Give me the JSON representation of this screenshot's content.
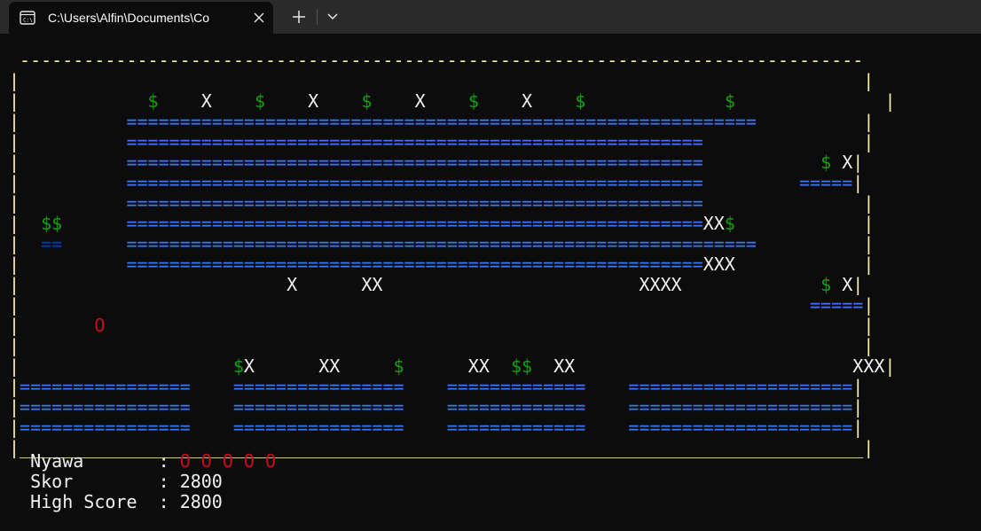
{
  "window": {
    "tab_title": "C:\\Users\\Alfin\\Documents\\Co",
    "tab_icon": "terminal-icon",
    "close_icon": "close-icon",
    "new_tab_icon": "plus-icon",
    "dropdown_icon": "chevron-down-icon"
  },
  "colors": {
    "border": "#f9f1a5",
    "coin": "#13a10e",
    "obstacle": "#f2f2f2",
    "platform": "#3b78ff",
    "platform_dark": "#0037da",
    "player": "#c50f1f",
    "background": "#0c0c0c",
    "titlebar": "#2a2a2a"
  },
  "screen": {
    "lines": [
      [
        {
          "c": "y",
          "t": " ------------------------------------------------------------------------------- "
        }
      ],
      [
        {
          "c": "y",
          "t": "|"
        },
        {
          "c": "w",
          "t": "                                                                               "
        },
        {
          "c": "y",
          "t": "|"
        }
      ],
      [
        {
          "c": "y",
          "t": "|"
        },
        {
          "c": "w",
          "t": "            "
        },
        {
          "c": "g",
          "t": "$"
        },
        {
          "c": "w",
          "t": "    X    "
        },
        {
          "c": "g",
          "t": "$"
        },
        {
          "c": "w",
          "t": "    X    "
        },
        {
          "c": "g",
          "t": "$"
        },
        {
          "c": "w",
          "t": "    X    "
        },
        {
          "c": "g",
          "t": "$"
        },
        {
          "c": "w",
          "t": "    X    "
        },
        {
          "c": "g",
          "t": "$"
        },
        {
          "c": "w",
          "t": "             "
        },
        {
          "c": "g",
          "t": "$"
        },
        {
          "c": "w",
          "t": "              "
        },
        {
          "c": "y",
          "t": "|"
        }
      ],
      [
        {
          "c": "y",
          "t": "|"
        },
        {
          "c": "w",
          "t": "          "
        },
        {
          "c": "b",
          "t": "==========================================================="
        },
        {
          "c": "w",
          "t": "          "
        },
        {
          "c": "y",
          "t": "|"
        }
      ],
      [
        {
          "c": "y",
          "t": "|"
        },
        {
          "c": "w",
          "t": "          "
        },
        {
          "c": "b",
          "t": "======================================================"
        },
        {
          "c": "w",
          "t": "               "
        },
        {
          "c": "y",
          "t": "|"
        }
      ],
      [
        {
          "c": "y",
          "t": "|"
        },
        {
          "c": "w",
          "t": "          "
        },
        {
          "c": "b",
          "t": "======================================================"
        },
        {
          "c": "w",
          "t": "           "
        },
        {
          "c": "g",
          "t": "$"
        },
        {
          "c": "w",
          "t": " X"
        },
        {
          "c": "y",
          "t": "|"
        }
      ],
      [
        {
          "c": "y",
          "t": "|"
        },
        {
          "c": "w",
          "t": "          "
        },
        {
          "c": "b",
          "t": "======================================================"
        },
        {
          "c": "w",
          "t": "         "
        },
        {
          "c": "b",
          "t": "====="
        },
        {
          "c": "y",
          "t": "|"
        }
      ],
      [
        {
          "c": "y",
          "t": "|"
        },
        {
          "c": "w",
          "t": "          "
        },
        {
          "c": "b",
          "t": "======================================================"
        },
        {
          "c": "w",
          "t": "               "
        },
        {
          "c": "y",
          "t": "|"
        }
      ],
      [
        {
          "c": "y",
          "t": "|"
        },
        {
          "c": "w",
          "t": "  "
        },
        {
          "c": "g",
          "t": "$$"
        },
        {
          "c": "w",
          "t": "      "
        },
        {
          "c": "b",
          "t": "======================================================"
        },
        {
          "c": "w",
          "t": "XX"
        },
        {
          "c": "g",
          "t": "$"
        },
        {
          "c": "w",
          "t": "            "
        },
        {
          "c": "y",
          "t": "|"
        }
      ],
      [
        {
          "c": "y",
          "t": "|"
        },
        {
          "c": "w",
          "t": "  "
        },
        {
          "c": "d",
          "t": "=="
        },
        {
          "c": "w",
          "t": "      "
        },
        {
          "c": "b",
          "t": "==========================================================="
        },
        {
          "c": "w",
          "t": "          "
        },
        {
          "c": "y",
          "t": "|"
        }
      ],
      [
        {
          "c": "y",
          "t": "|"
        },
        {
          "c": "w",
          "t": "          "
        },
        {
          "c": "b",
          "t": "======================================================"
        },
        {
          "c": "w",
          "t": "XXX            "
        },
        {
          "c": "y",
          "t": "|"
        }
      ],
      [
        {
          "c": "y",
          "t": "|"
        },
        {
          "c": "w",
          "t": "                         X      XX                        XXXX             "
        },
        {
          "c": "g",
          "t": "$"
        },
        {
          "c": "w",
          "t": " X"
        },
        {
          "c": "y",
          "t": "|"
        }
      ],
      [
        {
          "c": "y",
          "t": "|"
        },
        {
          "c": "w",
          "t": "                                                                          "
        },
        {
          "c": "b",
          "t": "====="
        },
        {
          "c": "y",
          "t": "|"
        }
      ],
      [
        {
          "c": "y",
          "t": "|"
        },
        {
          "c": "w",
          "t": "       "
        },
        {
          "c": "r",
          "t": "O"
        },
        {
          "c": "w",
          "t": "                                                                       "
        },
        {
          "c": "y",
          "t": "|"
        }
      ],
      [
        {
          "c": "y",
          "t": "|"
        },
        {
          "c": "w",
          "t": "                                                                               "
        },
        {
          "c": "y",
          "t": "|"
        }
      ],
      [
        {
          "c": "y",
          "t": "|"
        },
        {
          "c": "w",
          "t": "                    "
        },
        {
          "c": "g",
          "t": "$"
        },
        {
          "c": "w",
          "t": "X      XX     "
        },
        {
          "c": "g",
          "t": "$"
        },
        {
          "c": "w",
          "t": "      XX  "
        },
        {
          "c": "g",
          "t": "$$"
        },
        {
          "c": "w",
          "t": "  XX                          XXX"
        },
        {
          "c": "y",
          "t": "|"
        }
      ],
      [
        {
          "c": "y",
          "t": "|"
        },
        {
          "c": "b",
          "t": "================"
        },
        {
          "c": "w",
          "t": "    "
        },
        {
          "c": "b",
          "t": "================"
        },
        {
          "c": "w",
          "t": "    "
        },
        {
          "c": "b",
          "t": "============="
        },
        {
          "c": "w",
          "t": "    "
        },
        {
          "c": "b",
          "t": "====================="
        },
        {
          "c": "y",
          "t": "|"
        }
      ],
      [
        {
          "c": "y",
          "t": "|"
        },
        {
          "c": "b",
          "t": "================"
        },
        {
          "c": "w",
          "t": "    "
        },
        {
          "c": "b",
          "t": "================"
        },
        {
          "c": "w",
          "t": "    "
        },
        {
          "c": "b",
          "t": "============="
        },
        {
          "c": "w",
          "t": "    "
        },
        {
          "c": "b",
          "t": "====================="
        },
        {
          "c": "y",
          "t": "|"
        }
      ],
      [
        {
          "c": "y",
          "t": "|"
        },
        {
          "c": "b",
          "t": "================"
        },
        {
          "c": "w",
          "t": "    "
        },
        {
          "c": "b",
          "t": "================"
        },
        {
          "c": "w",
          "t": "    "
        },
        {
          "c": "b",
          "t": "============="
        },
        {
          "c": "w",
          "t": "    "
        },
        {
          "c": "b",
          "t": "====================="
        },
        {
          "c": "y",
          "t": "|"
        }
      ],
      [
        {
          "c": "y",
          "t": "|_______________________________________________________________________________|"
        }
      ]
    ]
  },
  "stats": {
    "lives_label": "Nyawa       ",
    "lives_sep": ": ",
    "lives_value": "O O O O O",
    "score_label": "Skor        ",
    "score_sep": ": ",
    "score_value": "2800",
    "high_label": "High Score  ",
    "high_sep": ": ",
    "high_value": "2800"
  }
}
